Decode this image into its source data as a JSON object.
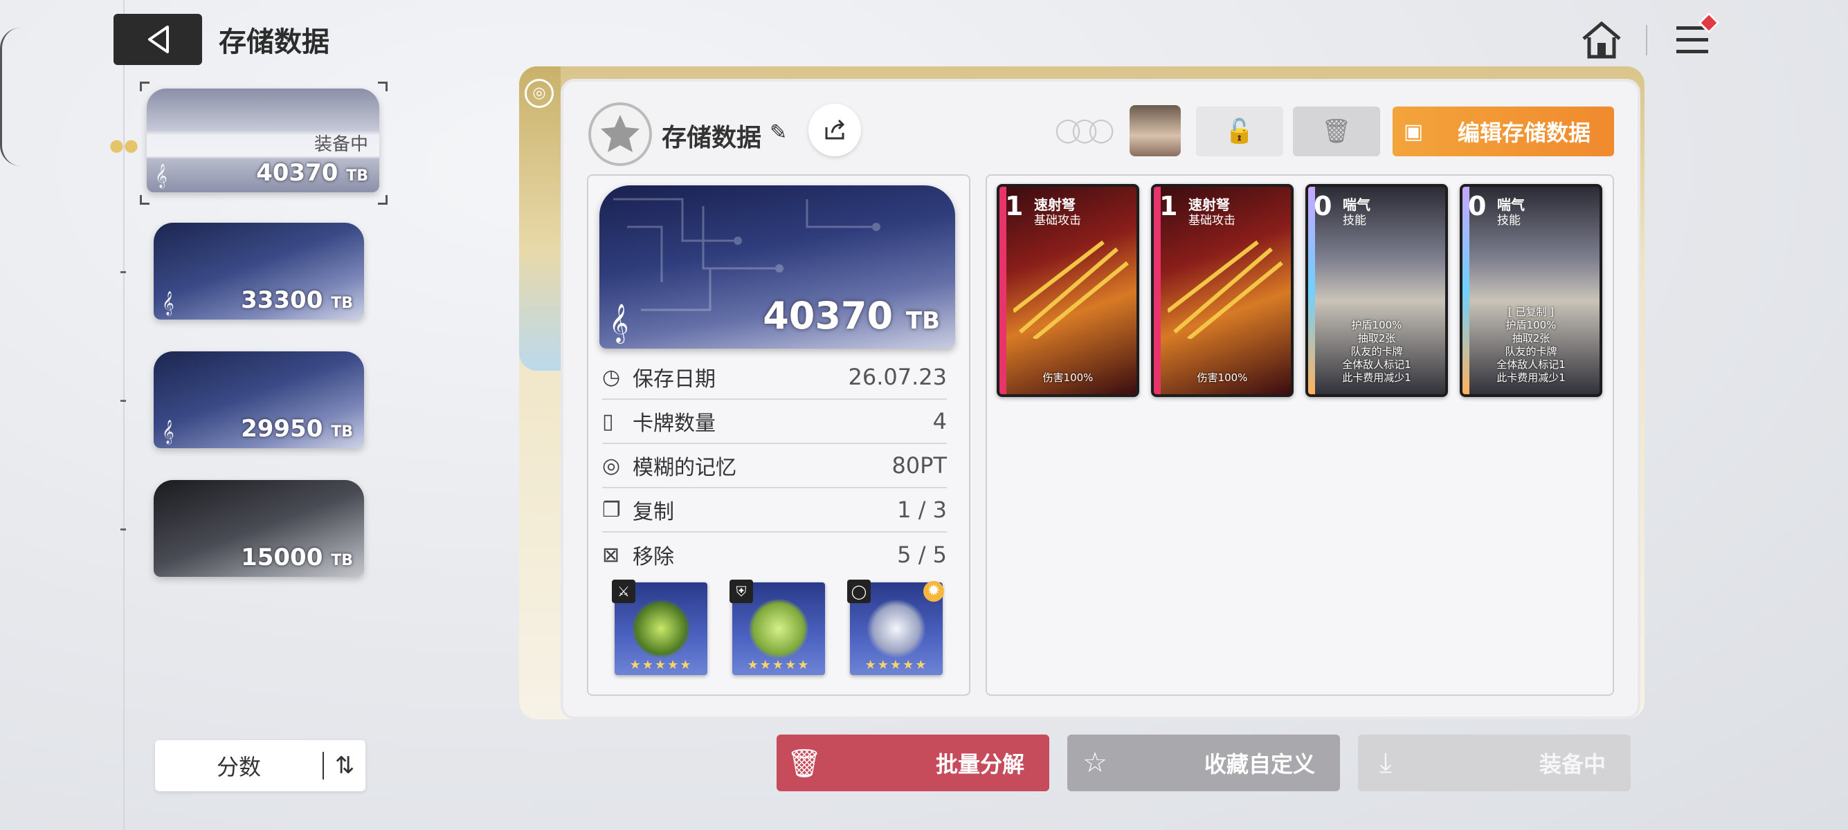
{
  "header": {
    "title": "存储数据"
  },
  "list": {
    "items": [
      {
        "score": "40370",
        "unit": "TB",
        "status": "装备中",
        "style": "active"
      },
      {
        "score": "33300",
        "unit": "TB",
        "style": "blue"
      },
      {
        "score": "29950",
        "unit": "TB",
        "style": "blue"
      },
      {
        "score": "15000",
        "unit": "TB",
        "style": "dark"
      }
    ],
    "sort_label": "分数"
  },
  "panel": {
    "title": "存储数据",
    "edit_label": "编辑存储数据",
    "card_score": "40370",
    "card_unit": "TB",
    "info": [
      {
        "label": "保存日期",
        "value": "26.07.23",
        "icon": "clock-icon"
      },
      {
        "label": "卡牌数量",
        "value": "4",
        "icon": "cards-icon"
      },
      {
        "label": "模糊的记忆",
        "value": "80PT",
        "icon": "brain-icon"
      },
      {
        "label": "复制",
        "value": "1 / 3",
        "icon": "copy-icon"
      },
      {
        "label": "移除",
        "value": "5 / 5",
        "icon": "remove-icon"
      }
    ],
    "gear": [
      {
        "slot": "weapon",
        "icon": "sword-icon",
        "stars": "★★★★★"
      },
      {
        "slot": "armor",
        "icon": "armor-icon",
        "stars": "★★★★★"
      },
      {
        "slot": "accessory",
        "icon": "ring-icon",
        "stars": "★★★★★"
      }
    ],
    "cards": [
      {
        "cost": "1",
        "name": "速射弩",
        "type": "基础攻击",
        "desc": [
          "伤害100%"
        ],
        "style": "red"
      },
      {
        "cost": "1",
        "name": "速射弩",
        "type": "基础攻击",
        "desc": [
          "伤害100%"
        ],
        "style": "red"
      },
      {
        "cost": "0",
        "name": "喘气",
        "type": "技能",
        "desc": [
          "护盾100%",
          "抽取2张",
          "队友的卡牌",
          "全体敌人标记1",
          "此卡费用减少1"
        ],
        "style": "skill"
      },
      {
        "cost": "0",
        "name": "喘气",
        "type": "技能",
        "desc": [
          "[ 已复制 ]",
          "护盾100%",
          "抽取2张",
          "队友的卡牌",
          "全体敌人标记1",
          "此卡费用减少1"
        ],
        "style": "skill"
      }
    ]
  },
  "actions": {
    "dismantle": "批量分解",
    "collect": "收藏自定义",
    "equip": "装备中"
  },
  "colors": {
    "accent": "#f08a2e",
    "danger": "#c64b5b"
  }
}
